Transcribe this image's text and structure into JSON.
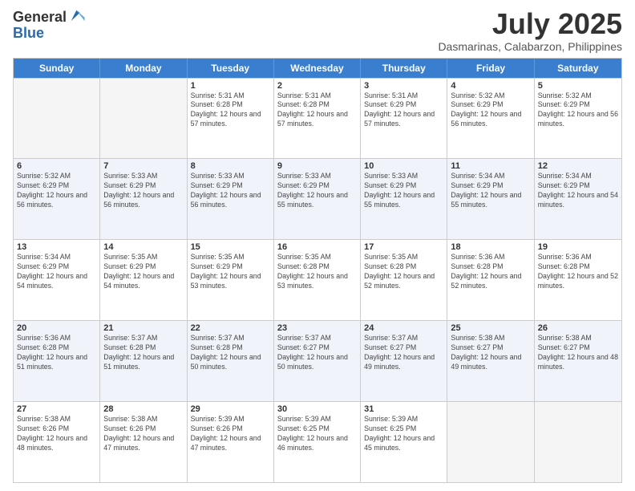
{
  "header": {
    "logo_general": "General",
    "logo_blue": "Blue",
    "title": "July 2025",
    "location": "Dasmarinas, Calabarzon, Philippines"
  },
  "days": [
    "Sunday",
    "Monday",
    "Tuesday",
    "Wednesday",
    "Thursday",
    "Friday",
    "Saturday"
  ],
  "weeks": [
    [
      {
        "date": "",
        "sunrise": "",
        "sunset": "",
        "daylight": "",
        "empty": true
      },
      {
        "date": "",
        "sunrise": "",
        "sunset": "",
        "daylight": "",
        "empty": true
      },
      {
        "date": "1",
        "sunrise": "Sunrise: 5:31 AM",
        "sunset": "Sunset: 6:28 PM",
        "daylight": "Daylight: 12 hours and 57 minutes.",
        "empty": false
      },
      {
        "date": "2",
        "sunrise": "Sunrise: 5:31 AM",
        "sunset": "Sunset: 6:28 PM",
        "daylight": "Daylight: 12 hours and 57 minutes.",
        "empty": false
      },
      {
        "date": "3",
        "sunrise": "Sunrise: 5:31 AM",
        "sunset": "Sunset: 6:29 PM",
        "daylight": "Daylight: 12 hours and 57 minutes.",
        "empty": false
      },
      {
        "date": "4",
        "sunrise": "Sunrise: 5:32 AM",
        "sunset": "Sunset: 6:29 PM",
        "daylight": "Daylight: 12 hours and 56 minutes.",
        "empty": false
      },
      {
        "date": "5",
        "sunrise": "Sunrise: 5:32 AM",
        "sunset": "Sunset: 6:29 PM",
        "daylight": "Daylight: 12 hours and 56 minutes.",
        "empty": false
      }
    ],
    [
      {
        "date": "6",
        "sunrise": "Sunrise: 5:32 AM",
        "sunset": "Sunset: 6:29 PM",
        "daylight": "Daylight: 12 hours and 56 minutes.",
        "empty": false
      },
      {
        "date": "7",
        "sunrise": "Sunrise: 5:33 AM",
        "sunset": "Sunset: 6:29 PM",
        "daylight": "Daylight: 12 hours and 56 minutes.",
        "empty": false
      },
      {
        "date": "8",
        "sunrise": "Sunrise: 5:33 AM",
        "sunset": "Sunset: 6:29 PM",
        "daylight": "Daylight: 12 hours and 56 minutes.",
        "empty": false
      },
      {
        "date": "9",
        "sunrise": "Sunrise: 5:33 AM",
        "sunset": "Sunset: 6:29 PM",
        "daylight": "Daylight: 12 hours and 55 minutes.",
        "empty": false
      },
      {
        "date": "10",
        "sunrise": "Sunrise: 5:33 AM",
        "sunset": "Sunset: 6:29 PM",
        "daylight": "Daylight: 12 hours and 55 minutes.",
        "empty": false
      },
      {
        "date": "11",
        "sunrise": "Sunrise: 5:34 AM",
        "sunset": "Sunset: 6:29 PM",
        "daylight": "Daylight: 12 hours and 55 minutes.",
        "empty": false
      },
      {
        "date": "12",
        "sunrise": "Sunrise: 5:34 AM",
        "sunset": "Sunset: 6:29 PM",
        "daylight": "Daylight: 12 hours and 54 minutes.",
        "empty": false
      }
    ],
    [
      {
        "date": "13",
        "sunrise": "Sunrise: 5:34 AM",
        "sunset": "Sunset: 6:29 PM",
        "daylight": "Daylight: 12 hours and 54 minutes.",
        "empty": false
      },
      {
        "date": "14",
        "sunrise": "Sunrise: 5:35 AM",
        "sunset": "Sunset: 6:29 PM",
        "daylight": "Daylight: 12 hours and 54 minutes.",
        "empty": false
      },
      {
        "date": "15",
        "sunrise": "Sunrise: 5:35 AM",
        "sunset": "Sunset: 6:29 PM",
        "daylight": "Daylight: 12 hours and 53 minutes.",
        "empty": false
      },
      {
        "date": "16",
        "sunrise": "Sunrise: 5:35 AM",
        "sunset": "Sunset: 6:28 PM",
        "daylight": "Daylight: 12 hours and 53 minutes.",
        "empty": false
      },
      {
        "date": "17",
        "sunrise": "Sunrise: 5:35 AM",
        "sunset": "Sunset: 6:28 PM",
        "daylight": "Daylight: 12 hours and 52 minutes.",
        "empty": false
      },
      {
        "date": "18",
        "sunrise": "Sunrise: 5:36 AM",
        "sunset": "Sunset: 6:28 PM",
        "daylight": "Daylight: 12 hours and 52 minutes.",
        "empty": false
      },
      {
        "date": "19",
        "sunrise": "Sunrise: 5:36 AM",
        "sunset": "Sunset: 6:28 PM",
        "daylight": "Daylight: 12 hours and 52 minutes.",
        "empty": false
      }
    ],
    [
      {
        "date": "20",
        "sunrise": "Sunrise: 5:36 AM",
        "sunset": "Sunset: 6:28 PM",
        "daylight": "Daylight: 12 hours and 51 minutes.",
        "empty": false
      },
      {
        "date": "21",
        "sunrise": "Sunrise: 5:37 AM",
        "sunset": "Sunset: 6:28 PM",
        "daylight": "Daylight: 12 hours and 51 minutes.",
        "empty": false
      },
      {
        "date": "22",
        "sunrise": "Sunrise: 5:37 AM",
        "sunset": "Sunset: 6:28 PM",
        "daylight": "Daylight: 12 hours and 50 minutes.",
        "empty": false
      },
      {
        "date": "23",
        "sunrise": "Sunrise: 5:37 AM",
        "sunset": "Sunset: 6:27 PM",
        "daylight": "Daylight: 12 hours and 50 minutes.",
        "empty": false
      },
      {
        "date": "24",
        "sunrise": "Sunrise: 5:37 AM",
        "sunset": "Sunset: 6:27 PM",
        "daylight": "Daylight: 12 hours and 49 minutes.",
        "empty": false
      },
      {
        "date": "25",
        "sunrise": "Sunrise: 5:38 AM",
        "sunset": "Sunset: 6:27 PM",
        "daylight": "Daylight: 12 hours and 49 minutes.",
        "empty": false
      },
      {
        "date": "26",
        "sunrise": "Sunrise: 5:38 AM",
        "sunset": "Sunset: 6:27 PM",
        "daylight": "Daylight: 12 hours and 48 minutes.",
        "empty": false
      }
    ],
    [
      {
        "date": "27",
        "sunrise": "Sunrise: 5:38 AM",
        "sunset": "Sunset: 6:26 PM",
        "daylight": "Daylight: 12 hours and 48 minutes.",
        "empty": false
      },
      {
        "date": "28",
        "sunrise": "Sunrise: 5:38 AM",
        "sunset": "Sunset: 6:26 PM",
        "daylight": "Daylight: 12 hours and 47 minutes.",
        "empty": false
      },
      {
        "date": "29",
        "sunrise": "Sunrise: 5:39 AM",
        "sunset": "Sunset: 6:26 PM",
        "daylight": "Daylight: 12 hours and 47 minutes.",
        "empty": false
      },
      {
        "date": "30",
        "sunrise": "Sunrise: 5:39 AM",
        "sunset": "Sunset: 6:25 PM",
        "daylight": "Daylight: 12 hours and 46 minutes.",
        "empty": false
      },
      {
        "date": "31",
        "sunrise": "Sunrise: 5:39 AM",
        "sunset": "Sunset: 6:25 PM",
        "daylight": "Daylight: 12 hours and 45 minutes.",
        "empty": false
      },
      {
        "date": "",
        "sunrise": "",
        "sunset": "",
        "daylight": "",
        "empty": true
      },
      {
        "date": "",
        "sunrise": "",
        "sunset": "",
        "daylight": "",
        "empty": true
      }
    ]
  ]
}
